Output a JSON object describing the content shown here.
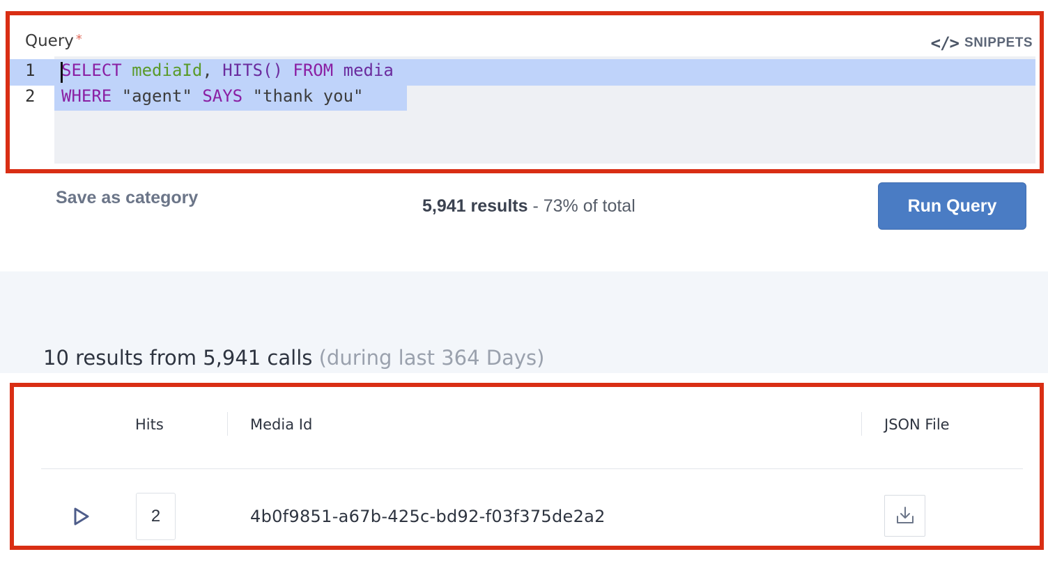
{
  "query": {
    "label": "Query",
    "required_marker": "*",
    "snippets_icon": "</>",
    "snippets_label": "SNIPPETS",
    "line_numbers": [
      "1",
      "2"
    ],
    "line1": {
      "select": "SELECT",
      "media_id": "mediaId",
      "comma": ",",
      "hits": "HITS()",
      "from": "FROM",
      "table": "media"
    },
    "line2": {
      "where": "WHERE",
      "speaker": "\"agent\"",
      "says": "SAYS",
      "phrase": "\"thank you\""
    }
  },
  "actions": {
    "save_category_label": "Save as category",
    "results_count": "5,941 results",
    "results_separator": " - ",
    "results_pct": "73% of total",
    "run_query_label": "Run Query"
  },
  "summary": {
    "main": "10 results from 5,941 calls",
    "period": "(during last 364 Days)"
  },
  "table": {
    "headers": {
      "hits": "Hits",
      "media_id": "Media Id",
      "json_file": "JSON File"
    },
    "rows": [
      {
        "hits": "2",
        "media_id": "4b0f9851-a67b-425c-bd92-f03f375de2a2"
      }
    ]
  },
  "colors": {
    "highlight_border": "#d92e14",
    "primary_button": "#4a7cc4",
    "selection": "#bfd3fa",
    "keyword": "#8a1fa3",
    "identifier": "#5a9a2a"
  },
  "icons": {
    "snippets": "code-icon",
    "play": "play-icon",
    "download": "download-icon"
  }
}
